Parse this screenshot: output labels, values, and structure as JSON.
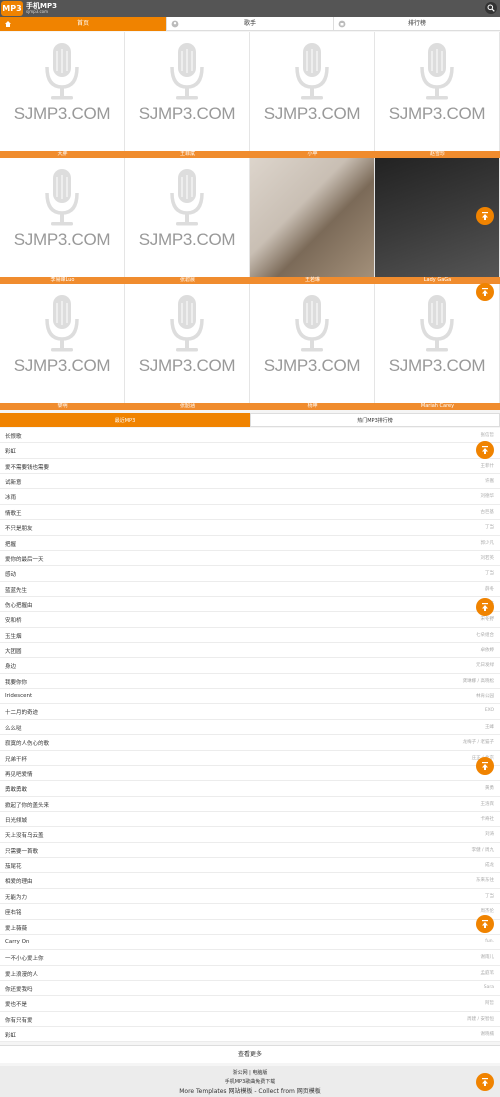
{
  "header": {
    "logo": "MP3",
    "title": "手机MP3",
    "subtitle": "sjmp3.com"
  },
  "tabs": [
    {
      "label": "首页",
      "icon": "home-icon",
      "active": true
    },
    {
      "label": "歌手",
      "icon": "singer-icon",
      "active": false
    },
    {
      "label": "排行榜",
      "icon": "chart-icon",
      "active": false
    }
  ],
  "placeholder_text": "SJMP3.COM",
  "singers": [
    {
      "name": "大胖"
    },
    {
      "name": "王菲斌"
    },
    {
      "name": "小苹"
    },
    {
      "name": "赵雪珍"
    },
    {
      "name": "李易峰Luo"
    },
    {
      "name": "张碧晨"
    },
    {
      "name": "王若琳"
    },
    {
      "name": "Lady GaGa"
    },
    {
      "name": "黎明"
    },
    {
      "name": "张韶涵"
    },
    {
      "name": "杨坤"
    },
    {
      "name": "Mariah Carey"
    }
  ],
  "section_tabs": [
    {
      "label": "最近MP3",
      "active": true
    },
    {
      "label": "热门MP3排行榜",
      "active": false
    }
  ],
  "songs": [
    {
      "title": "长恨歌",
      "artist": "张信哲"
    },
    {
      "title": "彩虹",
      "artist": "周杰伦"
    },
    {
      "title": "爱不需要钱也需要",
      "artist": "王菲什"
    },
    {
      "title": "试新意",
      "artist": "许嵩"
    },
    {
      "title": "冰雨",
      "artist": "刘德华"
    },
    {
      "title": "情歌王",
      "artist": "古巨基"
    },
    {
      "title": "不只是朋友",
      "artist": "丁当"
    },
    {
      "title": "把握",
      "artist": "郭少凡"
    },
    {
      "title": "爱你的最后一天",
      "artist": "刘若英"
    },
    {
      "title": "感动",
      "artist": "丁当"
    },
    {
      "title": "蓝蓝先生",
      "artist": "薛冬"
    },
    {
      "title": "伤心把握由",
      "artist": "刘若英"
    },
    {
      "title": "安和桥",
      "artist": "宋冬野"
    },
    {
      "title": "玉生烟",
      "artist": "七朵组合"
    },
    {
      "title": "大团圆",
      "artist": "卓依婷"
    },
    {
      "title": "身边",
      "artist": "元日发绿"
    },
    {
      "title": "我要你你",
      "artist": "龚琳娜 / 高晓松"
    },
    {
      "title": "Iridescent",
      "artist": "林肯公园"
    },
    {
      "title": "十二月的奇迹",
      "artist": "EXO"
    },
    {
      "title": "么么哒",
      "artist": "王峰"
    },
    {
      "title": "寂寞的人伤心的歌",
      "artist": "龙梅子 / 老猫子"
    },
    {
      "title": "兄弟干杯",
      "artist": "庄正 / 北京"
    },
    {
      "title": "再见吧爱情",
      "artist": ""
    },
    {
      "title": "勇敢勇敢",
      "artist": "黄勇"
    },
    {
      "title": "掀起了你的盖头来",
      "artist": "王洛宾"
    },
    {
      "title": "日光倾城",
      "artist": "卡奇社"
    },
    {
      "title": "天上没有乌云盖",
      "artist": "刘涛"
    },
    {
      "title": "只需要一首歌",
      "artist": "李健 / 周九"
    },
    {
      "title": "茄尾花",
      "artist": "成龙"
    },
    {
      "title": "相爱的理由",
      "artist": "东来东往"
    },
    {
      "title": "无能为力",
      "artist": "丁当"
    },
    {
      "title": "座右铭",
      "artist": "周杰伦"
    },
    {
      "title": "爱上薇薇",
      "artist": ""
    },
    {
      "title": "Carry On",
      "artist": "fun."
    },
    {
      "title": "一不小心爱上你",
      "artist": "谢雨儿"
    },
    {
      "title": "爱上浪漫的人",
      "artist": "孟庭苇"
    },
    {
      "title": "你还爱我吗",
      "artist": "Sara"
    },
    {
      "title": "爱也不是",
      "artist": "阿哲"
    },
    {
      "title": "你有只有爱",
      "artist": "周建 / 安智恒"
    },
    {
      "title": "彩虹",
      "artist": "谢晓楠"
    }
  ],
  "more_label": "查看更多",
  "footer": {
    "links": "浙公网  |  电脑版",
    "line2": "手机MP3歌曲免费下载",
    "line3": "More Templates 网站模板 - Collect from 网页模板"
  },
  "colors": {
    "accent": "#f08300",
    "topbar": "#555555"
  }
}
